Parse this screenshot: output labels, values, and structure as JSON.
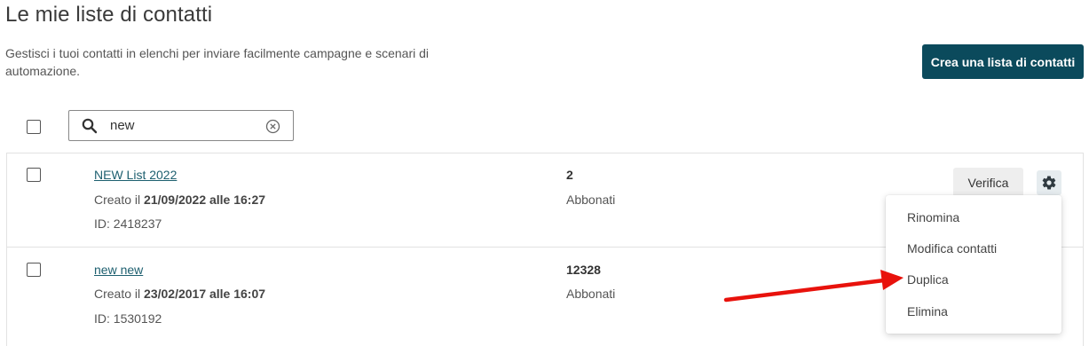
{
  "header": {
    "title": "Le mie liste di contatti",
    "description": "Gestisci i tuoi contatti in elenchi per inviare facilmente campagne e scenari di automazione.",
    "create_button": "Crea una lista di contatti"
  },
  "search": {
    "value": "new"
  },
  "lists": [
    {
      "name": "NEW List 2022",
      "created_prefix": "Creato il ",
      "created_value": "21/09/2022 alle 16:27",
      "id": "ID: 2418237",
      "count": "2",
      "unit": "Abbonati"
    },
    {
      "name": "new new",
      "created_prefix": "Creato il ",
      "created_value": "23/02/2017 alle 16:07",
      "id": "ID: 1530192",
      "count": "12328",
      "unit": "Abbonati"
    }
  ],
  "actions": {
    "verify": "Verifica"
  },
  "menu": {
    "items": [
      "Rinomina",
      "Modifica contatti",
      "Duplica",
      "Elimina"
    ]
  },
  "icons": {
    "search": "search-icon",
    "clear": "clear-circle-icon",
    "gear": "gear-icon",
    "annotation": "red-arrow-icon"
  },
  "colors": {
    "primary": "#0b4a5c",
    "link": "#1d5f6f",
    "annotation_arrow": "#e8120c"
  }
}
